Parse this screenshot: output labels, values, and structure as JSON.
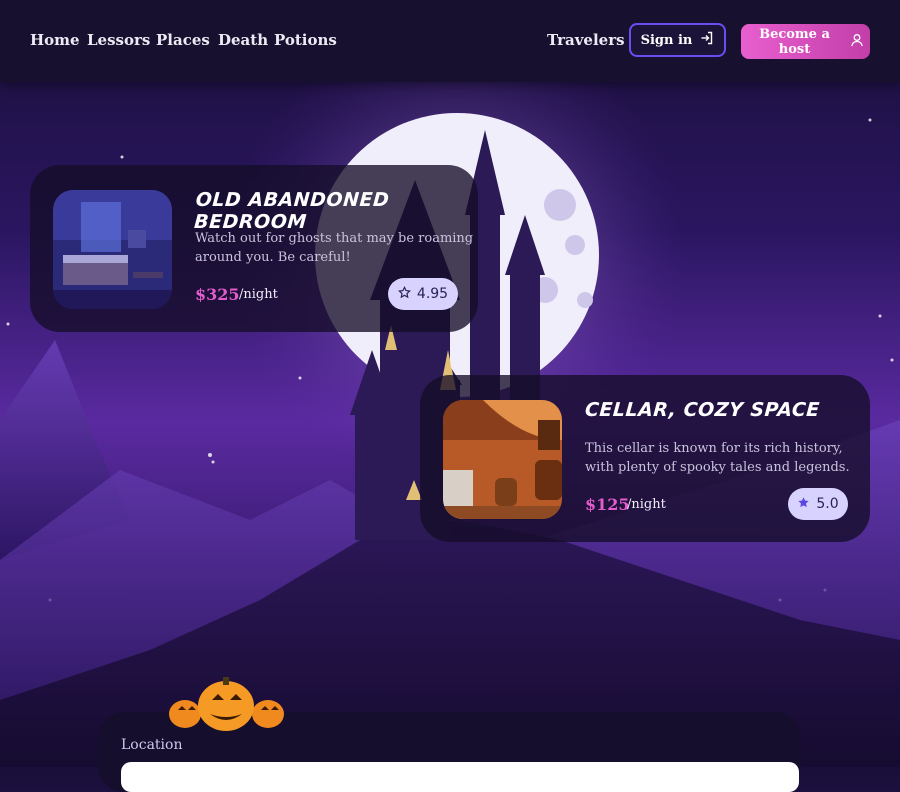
{
  "nav": {
    "links": [
      {
        "label": "Home"
      },
      {
        "label": "Lessors"
      },
      {
        "label": "Places"
      },
      {
        "label": "Death"
      },
      {
        "label": "Potions"
      }
    ],
    "travelers_label": "Travelers",
    "signin_label": "Sign in",
    "signin_icon": "login-icon",
    "host_label": "Become a host",
    "host_icon": "user-icon"
  },
  "listings": [
    {
      "title": "Old Abandoned Bedroom",
      "description": "Watch out for ghosts that may be roaming around you. Be careful!",
      "price": "$325",
      "per": "/night",
      "rating": "4.95",
      "rating_icon": "star-outline-icon"
    },
    {
      "title": "Cellar, Cozy Space",
      "description": "This cellar is known for its rich history, with plenty of spooky tales and legends.",
      "price": "$125",
      "per": "/night",
      "rating": "5.0",
      "rating_icon": "star-filled-icon"
    }
  ],
  "search": {
    "location_label": "Location",
    "location_value": ""
  },
  "colors": {
    "nav_bg": "#17112f",
    "accent_pink": "#e45bcd",
    "signin_border": "#6b4cf0",
    "rating_bg": "#d8d2ff"
  }
}
